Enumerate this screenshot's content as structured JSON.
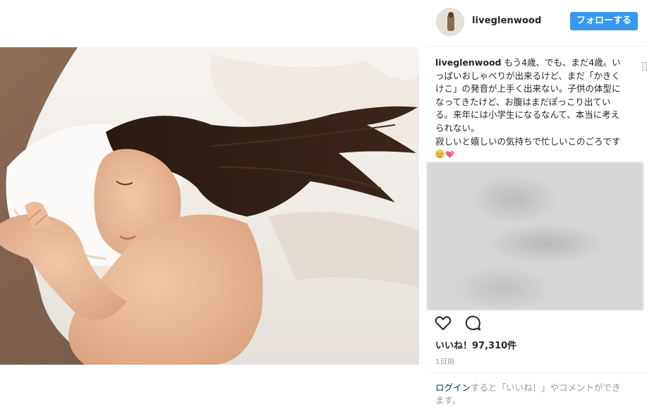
{
  "header": {
    "username": "liveglenwood",
    "follow_label": "フォローする"
  },
  "caption": {
    "username": "liveglenwood",
    "text_main": "もう4歳、でも、まだ4歳。いっぱいおしゃべりが出来るけど、まだ「かきくけこ」の発音が上手く出来ない。子供の体型になってきたけど、お腹はまだぽっこり出ている。来年には小学生になるなんて、本当に考えられない。",
    "text_second": "寂しいと嬉しいの気持ちで忙しいこのごろです",
    "emojis": [
      "relieved-face-emoji",
      "sparkling-heart-emoji"
    ]
  },
  "actions": {
    "like_icon": "heart-icon",
    "comment_icon": "comment-icon"
  },
  "likes": {
    "label": "いいね！97,310件"
  },
  "timestamp": "1日前",
  "login_prompt": {
    "link": "ログイン",
    "text": "すると「いいね！」やコメントができます。"
  },
  "colors": {
    "follow_button": "#3897f0",
    "text": "#262626",
    "muted": "#999999",
    "link": "#003569"
  }
}
